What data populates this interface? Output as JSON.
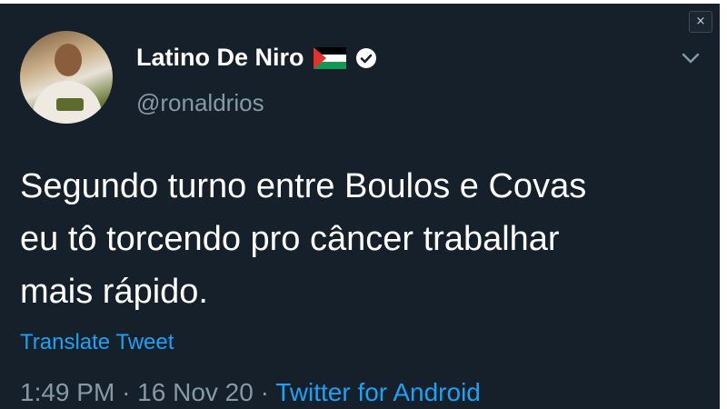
{
  "tweet": {
    "author": {
      "display_name": "Latino De Niro",
      "handle": "@ronaldrios",
      "flag_icon": "palestine-flag",
      "verified_icon": "verified-badge-icon"
    },
    "text_lines": [
      "Segundo turno entre Boulos e Covas",
      "eu tô torcendo pro câncer trabalhar",
      "mais rápido."
    ],
    "translate_label": "Translate Tweet",
    "time": "1:49 PM",
    "separator": "·",
    "date": "16 Nov 20",
    "source": "Twitter for Android"
  },
  "ui": {
    "close_glyph": "×",
    "colors": {
      "background": "#15202b",
      "text": "#ffffff",
      "muted": "#8899a6",
      "link": "#1da1f2"
    }
  }
}
